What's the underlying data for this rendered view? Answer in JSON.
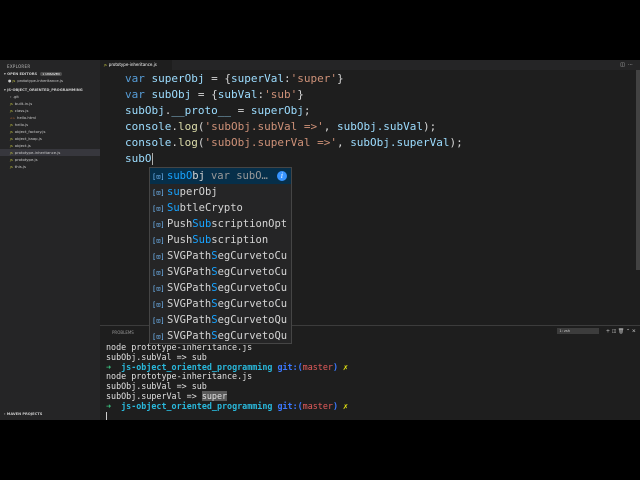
{
  "sidebar": {
    "title": "EXPLORER",
    "open_editors": {
      "label": "OPEN EDITORS",
      "badge": "1 UNSAVED",
      "file": "prototype-inheritance.js"
    },
    "project": "JS-OBJECT_ORIENTED_PROGRAMMING",
    "files": [
      {
        "name": ".git"
      },
      {
        "name": "built-in.js"
      },
      {
        "name": "class.js"
      },
      {
        "name": "hello.html"
      },
      {
        "name": "hello.js"
      },
      {
        "name": "object_factory.js"
      },
      {
        "name": "object_kaap.js"
      },
      {
        "name": "object.js"
      },
      {
        "name": "prototype-inheritance.js"
      },
      {
        "name": "prototype.js"
      },
      {
        "name": "this.js"
      }
    ],
    "maven": "MAVEN PROJECTS"
  },
  "tabs": [
    {
      "label": "prototype-inheritance.js"
    }
  ],
  "editor": {
    "line1": {
      "kw": "var",
      "name": "superObj",
      "eq": " = {",
      "prop": "superVal",
      "colon": ":",
      "str": "'super'",
      "close": "}"
    },
    "line2": {
      "kw": "var",
      "name": "subObj",
      "eq": " = {",
      "prop": "subVal",
      "colon": ":",
      "str": "'sub'",
      "close": "}"
    },
    "line3": {
      "obj": "subObj",
      "dot": ".",
      "prop": "__proto__",
      "eq": " = ",
      "val": "superObj",
      "end": ";"
    },
    "line4": {
      "obj": "console",
      "dot": ".",
      "fn": "log",
      "open": "(",
      "str": "'subObj.subVal =>'",
      "sep": ", ",
      "arg": "subObj.subVal",
      "end": ");"
    },
    "line5": {
      "obj": "console",
      "dot": ".",
      "fn": "log",
      "open": "(",
      "str": "'subObj.superVal =>'",
      "sep": ", ",
      "arg": "subObj.superVal",
      "end": ");"
    },
    "line6": {
      "typed": "subO"
    }
  },
  "suggestions": [
    {
      "pre": "",
      "hl": "subO",
      "post": "bj",
      "detail": "var subO…",
      "icon": "variable-icon"
    },
    {
      "pre": "",
      "hl": "su",
      "post": "perObj"
    },
    {
      "pre": "",
      "hl": "Su",
      "post": "btleCrypto"
    },
    {
      "pre": "Push",
      "hl": "Sub",
      "post": "scriptionOpt"
    },
    {
      "pre": "Push",
      "hl": "Sub",
      "post": "scription"
    },
    {
      "pre": "SVGPath",
      "hl": "S",
      "post": "egCurvetoCu"
    },
    {
      "pre": "SVGPath",
      "hl": "S",
      "post": "egCurvetoCu"
    },
    {
      "pre": "SVGPath",
      "hl": "S",
      "post": "egCurvetoCu"
    },
    {
      "pre": "SVGPath",
      "hl": "S",
      "post": "egCurvetoCu"
    },
    {
      "pre": "SVGPath",
      "hl": "S",
      "post": "egCurvetoQu"
    },
    {
      "pre": "SVGPath",
      "hl": "S",
      "post": "egCurvetoQu"
    }
  ],
  "panel": {
    "tab_problems": "PROBLEMS",
    "terminal_select": "1: zsh"
  },
  "terminal": {
    "l1": "node prototype-inheritance.js",
    "l2": "subObj.subVal => sub",
    "prompt": {
      "arrow": "➜",
      "dir": "js-object_oriented_programming",
      "git": "git:(",
      "branch": "master",
      "git_close": ")",
      "x": "✗"
    },
    "l4": "node prototype-inheritance.js",
    "l5": "subObj.subVal => sub",
    "l6_pre": "subObj.superVal => ",
    "l6_hl": "super"
  },
  "colors": {
    "accent": "#18a3ff",
    "keyword": "#569cd6",
    "string": "#ce9178",
    "terminal_green": "#3ac27f"
  }
}
